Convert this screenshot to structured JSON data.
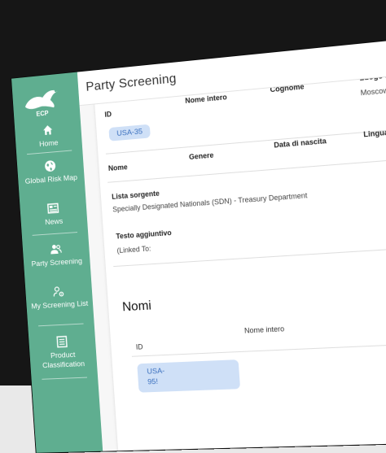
{
  "sidebar": {
    "logo_text": "ECP",
    "items": [
      {
        "label": "Home"
      },
      {
        "label": "Global Risk Map"
      },
      {
        "label": "News"
      },
      {
        "label": "Party Screening"
      },
      {
        "label": "My Screening List"
      },
      {
        "label": "Product Classification"
      }
    ]
  },
  "header": {
    "title": "Party Screening"
  },
  "record": {
    "columns1": [
      "ID",
      "Nome intero",
      "Cognome",
      "Luogo di n"
    ],
    "id_value": "USA-35",
    "location_value": "Moscow, R",
    "columns2": [
      "Nome",
      "Genere",
      "Data di nascita",
      "Lingua"
    ],
    "source_label": "Lista sorgente",
    "source_value": "Specially Designated Nationals (SDN) - Treasury Department",
    "extra_label": "Testo aggiuntivo",
    "extra_value": "(Linked To:"
  },
  "names_section": {
    "title": "Nomi",
    "columns": [
      "ID",
      "Nome intero"
    ],
    "id_value_line1": "USA-",
    "id_value_line2": "95!"
  },
  "colors": {
    "sidebar": "#5fae90",
    "chip_bg": "#cfe0f7",
    "chip_text": "#3a6fbe"
  }
}
